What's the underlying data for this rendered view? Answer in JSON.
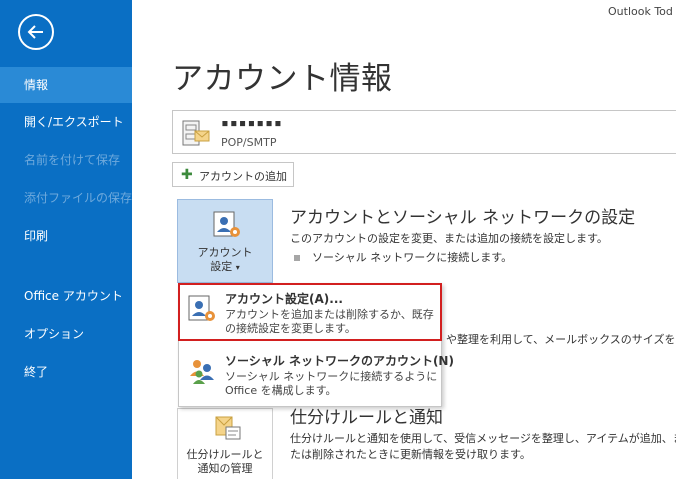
{
  "app": {
    "title": "Outlook Tod"
  },
  "sidebar": {
    "items": [
      {
        "label": "情報",
        "state": "active"
      },
      {
        "label": "開く/エクスポート",
        "state": "normal"
      },
      {
        "label": "名前を付けて保存",
        "state": "disabled"
      },
      {
        "label": "添付ファイルの保存",
        "state": "disabled"
      },
      {
        "label": "印刷",
        "state": "normal"
      },
      {
        "label": "Office アカウント",
        "state": "normal"
      },
      {
        "label": "オプション",
        "state": "normal"
      },
      {
        "label": "終了",
        "state": "normal"
      }
    ]
  },
  "page": {
    "title": "アカウント情報"
  },
  "account": {
    "name": "▪▪▪▪▪▪▪",
    "type": "POP/SMTP"
  },
  "add_account": {
    "label": "アカウントの追加"
  },
  "account_settings_section": {
    "button_label_line1": "アカウント",
    "button_label_line2": "設定",
    "title": "アカウントとソーシャル ネットワークの設定",
    "description": "このアカウントの設定を変更、または追加の接続を設定します。",
    "bullet": "ソーシャル ネットワークに接続します。"
  },
  "dropdown": {
    "items": [
      {
        "title": "アカウント設定(A)...",
        "desc_line1": "アカウントを追加または削除するか、既存",
        "desc_line2": "の接続設定を変更します。"
      },
      {
        "title": "ソーシャル ネットワークのアカウント(N)",
        "desc_line1": "ソーシャル ネットワークに接続するように",
        "desc_line2": "Office を構成します。"
      }
    ]
  },
  "mailbox_section": {
    "partial_text": "や整理を利用して、メールボックスのサイズを管"
  },
  "rules_section": {
    "button_label_line1": "仕分けルールと",
    "button_label_line2": "通知の管理",
    "title": "仕分けルールと通知",
    "desc_line1": "仕分けルールと通知を使用して、受信メッセージを整理し、アイテムが追加、または",
    "desc_line2": "たは削除されたときに更新情報を受け取ります。"
  },
  "colors": {
    "sidebar": "#0a6fc4",
    "sidebar_active": "#2a8ad6",
    "highlight": "#d21f1f",
    "tile_selected": "#c8ddf2"
  }
}
